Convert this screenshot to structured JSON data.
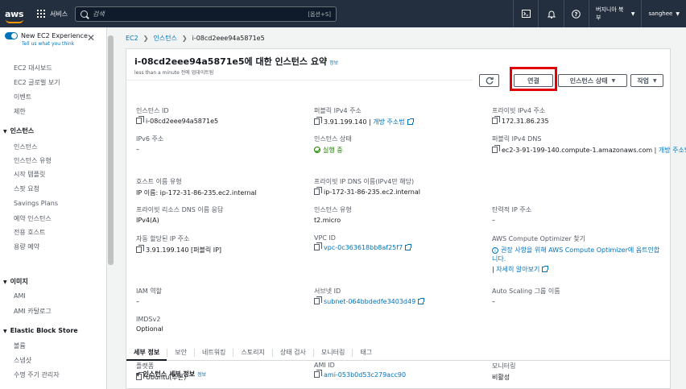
{
  "topbar": {
    "logo": "aws",
    "services_label": "서비스",
    "search_placeholder": "검색",
    "search_shortcut": "[옵션+S]",
    "icons": [
      "cloudshell-icon",
      "bell-icon",
      "help-icon"
    ],
    "region": "버지니아 북부",
    "user": "sanghee"
  },
  "sidebar": {
    "toggle_label": "New EC2 Experience",
    "toggle_link": "Tell us what you think",
    "items_top": [
      "EC2 대시보드",
      "EC2 글로벌 보기",
      "이벤트",
      "제한"
    ],
    "section_instances": "인스턴스",
    "instances_items": [
      "인스턴스",
      "인스턴스 유형",
      "시작 템플릿",
      "스팟 요청",
      "Savings Plans",
      "예약 인스턴스",
      "전용 호스트",
      "용량 예약"
    ],
    "section_images": "이미지",
    "images_items": [
      "AMI",
      "AMI 카탈로그"
    ],
    "section_ebs": "Elastic Block Store",
    "ebs_items": [
      "볼륨",
      "스냅샷",
      "수명 주기 관리자"
    ]
  },
  "breadcrumb": {
    "ec2": "EC2",
    "instances": "인스턴스",
    "current": "i-08cd2eee94a5871e5"
  },
  "summary": {
    "title": "i-08cd2eee94a5871e5에 대한 인스턴스 요약",
    "info": "정보",
    "updated": "less than a minute 전에 업데이트됨",
    "btn_connect": "연결",
    "btn_state": "인스턴스 상태",
    "btn_actions": "작업"
  },
  "fields": {
    "instance_id_label": "인스턴스 ID",
    "instance_id": "i-08cd2eee94a5871e5",
    "public_ipv4_label": "퍼블릭 IPv4 주소",
    "public_ipv4": "3.91.199.140",
    "public_ipv4_open": "개방 주소법",
    "private_ipv4_label": "프라이빗 IPv4 주소",
    "private_ipv4": "172.31.86.235",
    "ipv6_label": "IPv6 주소",
    "ipv6": "–",
    "state_label": "인스턴스 상태",
    "state": "실행 중",
    "public_dns_label": "퍼블릭 IPv4 DNS",
    "public_dns": "ec2-3-91-199-140.compute-1.amazonaws.com",
    "public_dns_open": "개방 주소법",
    "hostname_type_label": "호스트 이름 유형",
    "hostname_type": "IP 이름: ip-172-31-86-235.ec2.internal",
    "private_dns_label": "프라이빗 IP DNS 이름(IPv4만 해당)",
    "private_dns": "ip-172-31-86-235.ec2.internal",
    "resource_dns_label": "프라이빗 리소스 DNS 이름 응답",
    "resource_dns": "IPv4(A)",
    "instance_type_label": "인스턴스 유형",
    "instance_type": "t2.micro",
    "elastic_ip_label": "탄력적 IP 주소",
    "elastic_ip": "–",
    "auto_ip_label": "자동 할당된 IP 주소",
    "auto_ip": "3.91.199.140 [퍼블릭 IP]",
    "vpc_label": "VPC ID",
    "vpc": "vpc-0c363618bb8af25f7",
    "optimizer_label": "AWS Compute Optimizer 찾기",
    "optimizer_text": "권장 사항을 위해 AWS Compute Optimizer에 옵트인합니다.",
    "optimizer_link": "자세히 알아보기",
    "iam_label": "IAM 역할",
    "iam": "–",
    "subnet_label": "서브넷 ID",
    "subnet": "subnet-064bbdedfe3403d49",
    "asg_label": "Auto Scaling 그룹 이름",
    "asg": "–",
    "imds_label": "IMDSv2",
    "imds": "Optional"
  },
  "tabs": [
    "세부 정보",
    "보안",
    "네트워킹",
    "스토리지",
    "상태 검사",
    "모니터링",
    "태그"
  ],
  "details": {
    "header": "인스턴스 세부 정보",
    "info": "정보",
    "platform_label": "플랫폼",
    "platform": "Ubuntu(추론)",
    "ami_label": "AMI ID",
    "ami": "ami-053b0d53c279acc90",
    "monitoring_label": "모니터링",
    "monitoring": "비활성"
  }
}
